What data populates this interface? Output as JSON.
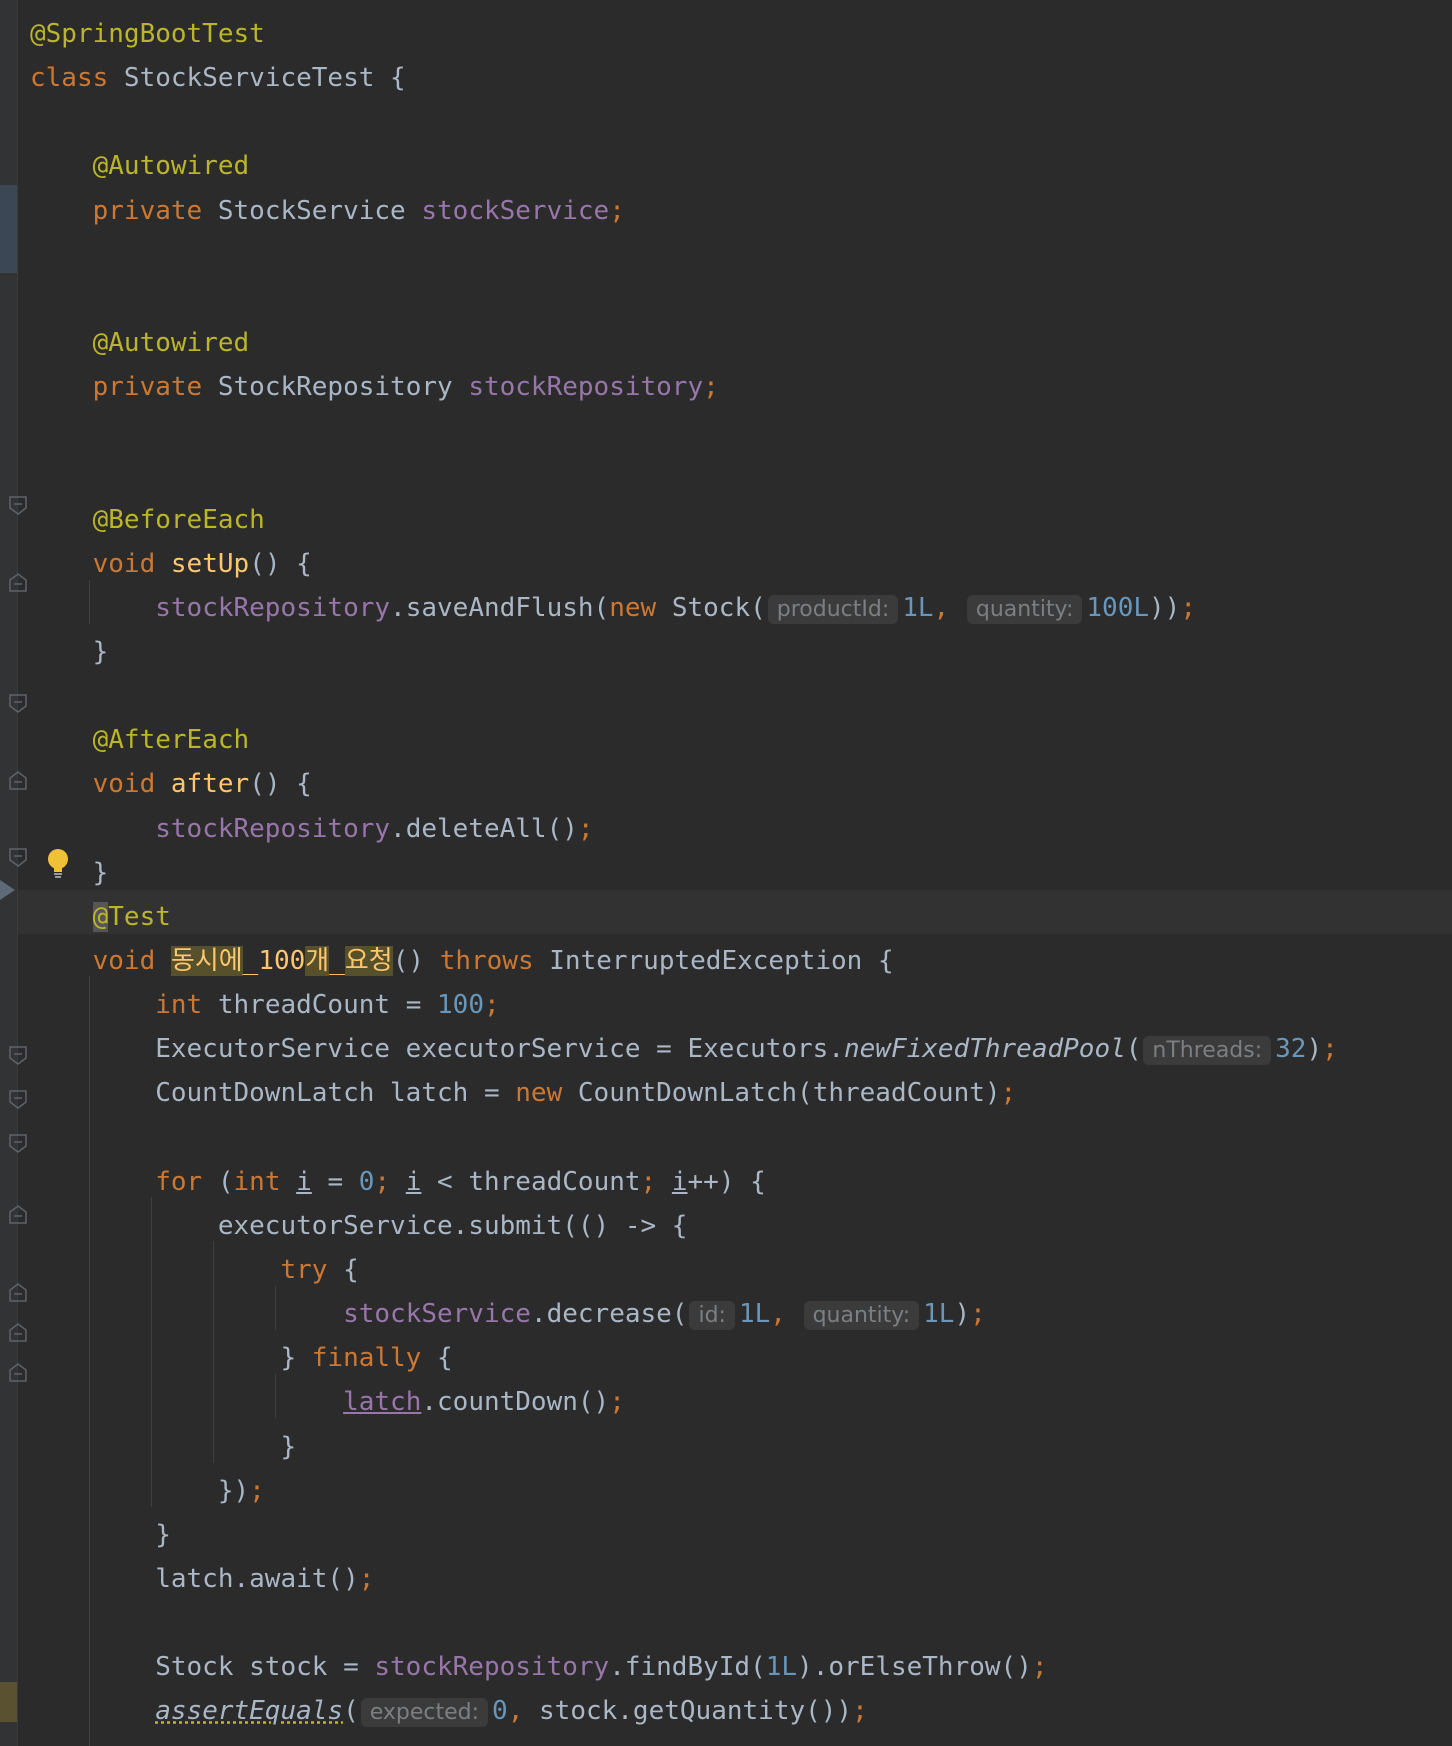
{
  "editor": {
    "lines": [
      [
        {
          "t": "@SpringBootTest",
          "c": "ann"
        }
      ],
      [
        {
          "t": "class",
          "c": "kw"
        },
        {
          "t": " StockServiceTest {"
        }
      ],
      [],
      [
        {
          "t": "    "
        },
        {
          "t": "@Autowired",
          "c": "ann"
        }
      ],
      [
        {
          "t": "    "
        },
        {
          "t": "private",
          "c": "kw"
        },
        {
          "t": " StockService "
        },
        {
          "t": "stockService",
          "c": "fld"
        },
        {
          "t": ";",
          "c": "kw"
        }
      ],
      [],
      [],
      [
        {
          "t": "    "
        },
        {
          "t": "@Autowired",
          "c": "ann"
        }
      ],
      [
        {
          "t": "    "
        },
        {
          "t": "private",
          "c": "kw"
        },
        {
          "t": " StockRepository "
        },
        {
          "t": "stockRepository",
          "c": "fld"
        },
        {
          "t": ";",
          "c": "kw"
        }
      ],
      [],
      [],
      [
        {
          "t": "    "
        },
        {
          "t": "@BeforeEach",
          "c": "ann"
        }
      ],
      [
        {
          "t": "    "
        },
        {
          "t": "void",
          "c": "kw"
        },
        {
          "t": " "
        },
        {
          "t": "setUp",
          "c": "fn"
        },
        {
          "t": "() {"
        }
      ],
      [
        {
          "t": "        "
        },
        {
          "t": "stockRepository",
          "c": "fld"
        },
        {
          "t": ".saveAndFlush("
        },
        {
          "t": "new",
          "c": "kw"
        },
        {
          "t": " Stock("
        },
        {
          "t": "productId:",
          "c": "hint"
        },
        {
          "t": "1L",
          "c": "num"
        },
        {
          "t": ", ",
          "c": "kw"
        },
        {
          "t": "quantity:",
          "c": "hint"
        },
        {
          "t": "100L",
          "c": "num"
        },
        {
          "t": "))"
        },
        {
          "t": ";",
          "c": "kw"
        }
      ],
      [
        {
          "t": "    }"
        }
      ],
      [],
      [
        {
          "t": "    "
        },
        {
          "t": "@AfterEach",
          "c": "ann"
        }
      ],
      [
        {
          "t": "    "
        },
        {
          "t": "void",
          "c": "kw"
        },
        {
          "t": " "
        },
        {
          "t": "after",
          "c": "fn"
        },
        {
          "t": "() {"
        }
      ],
      [
        {
          "t": "        "
        },
        {
          "t": "stockRepository",
          "c": "fld"
        },
        {
          "t": ".deleteAll()"
        },
        {
          "t": ";",
          "c": "kw"
        }
      ],
      [
        {
          "t": "    }"
        }
      ],
      [
        {
          "t": "    "
        },
        {
          "t": "@",
          "c": "caret"
        },
        {
          "t": "Test",
          "c": "ann"
        }
      ],
      [
        {
          "t": "    "
        },
        {
          "t": "void",
          "c": "kw"
        },
        {
          "t": " "
        },
        {
          "t": "동시에",
          "c": "hl"
        },
        {
          "t": "_100",
          "c": "fn"
        },
        {
          "t": "개",
          "c": "hl"
        },
        {
          "t": "_",
          "c": "fn"
        },
        {
          "t": "요청",
          "c": "hl"
        },
        {
          "t": "() "
        },
        {
          "t": "throws",
          "c": "kw"
        },
        {
          "t": " InterruptedException {"
        }
      ],
      [
        {
          "t": "        "
        },
        {
          "t": "int",
          "c": "kw"
        },
        {
          "t": " threadCount = "
        },
        {
          "t": "100",
          "c": "num"
        },
        {
          "t": ";",
          "c": "kw"
        }
      ],
      [
        {
          "t": "        ExecutorService executorService = Executors."
        },
        {
          "t": "newFixedThreadPool",
          "c": "it"
        },
        {
          "t": "("
        },
        {
          "t": "nThreads:",
          "c": "hint"
        },
        {
          "t": "32",
          "c": "num"
        },
        {
          "t": ")"
        },
        {
          "t": ";",
          "c": "kw"
        }
      ],
      [
        {
          "t": "        CountDownLatch latch = "
        },
        {
          "t": "new",
          "c": "kw"
        },
        {
          "t": " CountDownLatch(threadCount)"
        },
        {
          "t": ";",
          "c": "kw"
        }
      ],
      [],
      [
        {
          "t": "        "
        },
        {
          "t": "for",
          "c": "kw"
        },
        {
          "t": " ("
        },
        {
          "t": "int",
          "c": "kw"
        },
        {
          "t": " "
        },
        {
          "t": "i",
          "c": "ul"
        },
        {
          "t": " = "
        },
        {
          "t": "0",
          "c": "num"
        },
        {
          "t": "; ",
          "c": "kw"
        },
        {
          "t": "i",
          "c": "ul"
        },
        {
          "t": " < threadCount"
        },
        {
          "t": "; ",
          "c": "kw"
        },
        {
          "t": "i",
          "c": "ul"
        },
        {
          "t": "++) {"
        }
      ],
      [
        {
          "t": "            executorService.submit(() -> {"
        }
      ],
      [
        {
          "t": "                "
        },
        {
          "t": "try",
          "c": "kw"
        },
        {
          "t": " {"
        }
      ],
      [
        {
          "t": "                    "
        },
        {
          "t": "stockService",
          "c": "fld"
        },
        {
          "t": ".decrease("
        },
        {
          "t": "id:",
          "c": "hint"
        },
        {
          "t": "1L",
          "c": "num"
        },
        {
          "t": ", ",
          "c": "kw"
        },
        {
          "t": "quantity:",
          "c": "hint"
        },
        {
          "t": "1L",
          "c": "num"
        },
        {
          "t": ")"
        },
        {
          "t": ";",
          "c": "kw"
        }
      ],
      [
        {
          "t": "                } "
        },
        {
          "t": "finally",
          "c": "kw"
        },
        {
          "t": " {"
        }
      ],
      [
        {
          "t": "                    "
        },
        {
          "t": "latch",
          "c": "fld ul"
        },
        {
          "t": ".countDown()"
        },
        {
          "t": ";",
          "c": "kw"
        }
      ],
      [
        {
          "t": "                }"
        }
      ],
      [
        {
          "t": "            })"
        },
        {
          "t": ";",
          "c": "kw"
        }
      ],
      [
        {
          "t": "        }"
        }
      ],
      [
        {
          "t": "        latch.await()"
        },
        {
          "t": ";",
          "c": "kw"
        }
      ],
      [],
      [
        {
          "t": "        Stock stock = "
        },
        {
          "t": "stockRepository",
          "c": "fld"
        },
        {
          "t": ".findById("
        },
        {
          "t": "1L",
          "c": "num"
        },
        {
          "t": ").orElseThrow()"
        },
        {
          "t": ";",
          "c": "kw"
        }
      ],
      [
        {
          "t": "        "
        },
        {
          "t": "assertEquals",
          "c": "it dotted"
        },
        {
          "t": "("
        },
        {
          "t": "expected:",
          "c": "hint"
        },
        {
          "t": "0",
          "c": "num"
        },
        {
          "t": ", ",
          "c": "kw"
        },
        {
          "t": "stock.getQuantity())"
        },
        {
          "t": ";",
          "c": "kw"
        }
      ]
    ]
  }
}
